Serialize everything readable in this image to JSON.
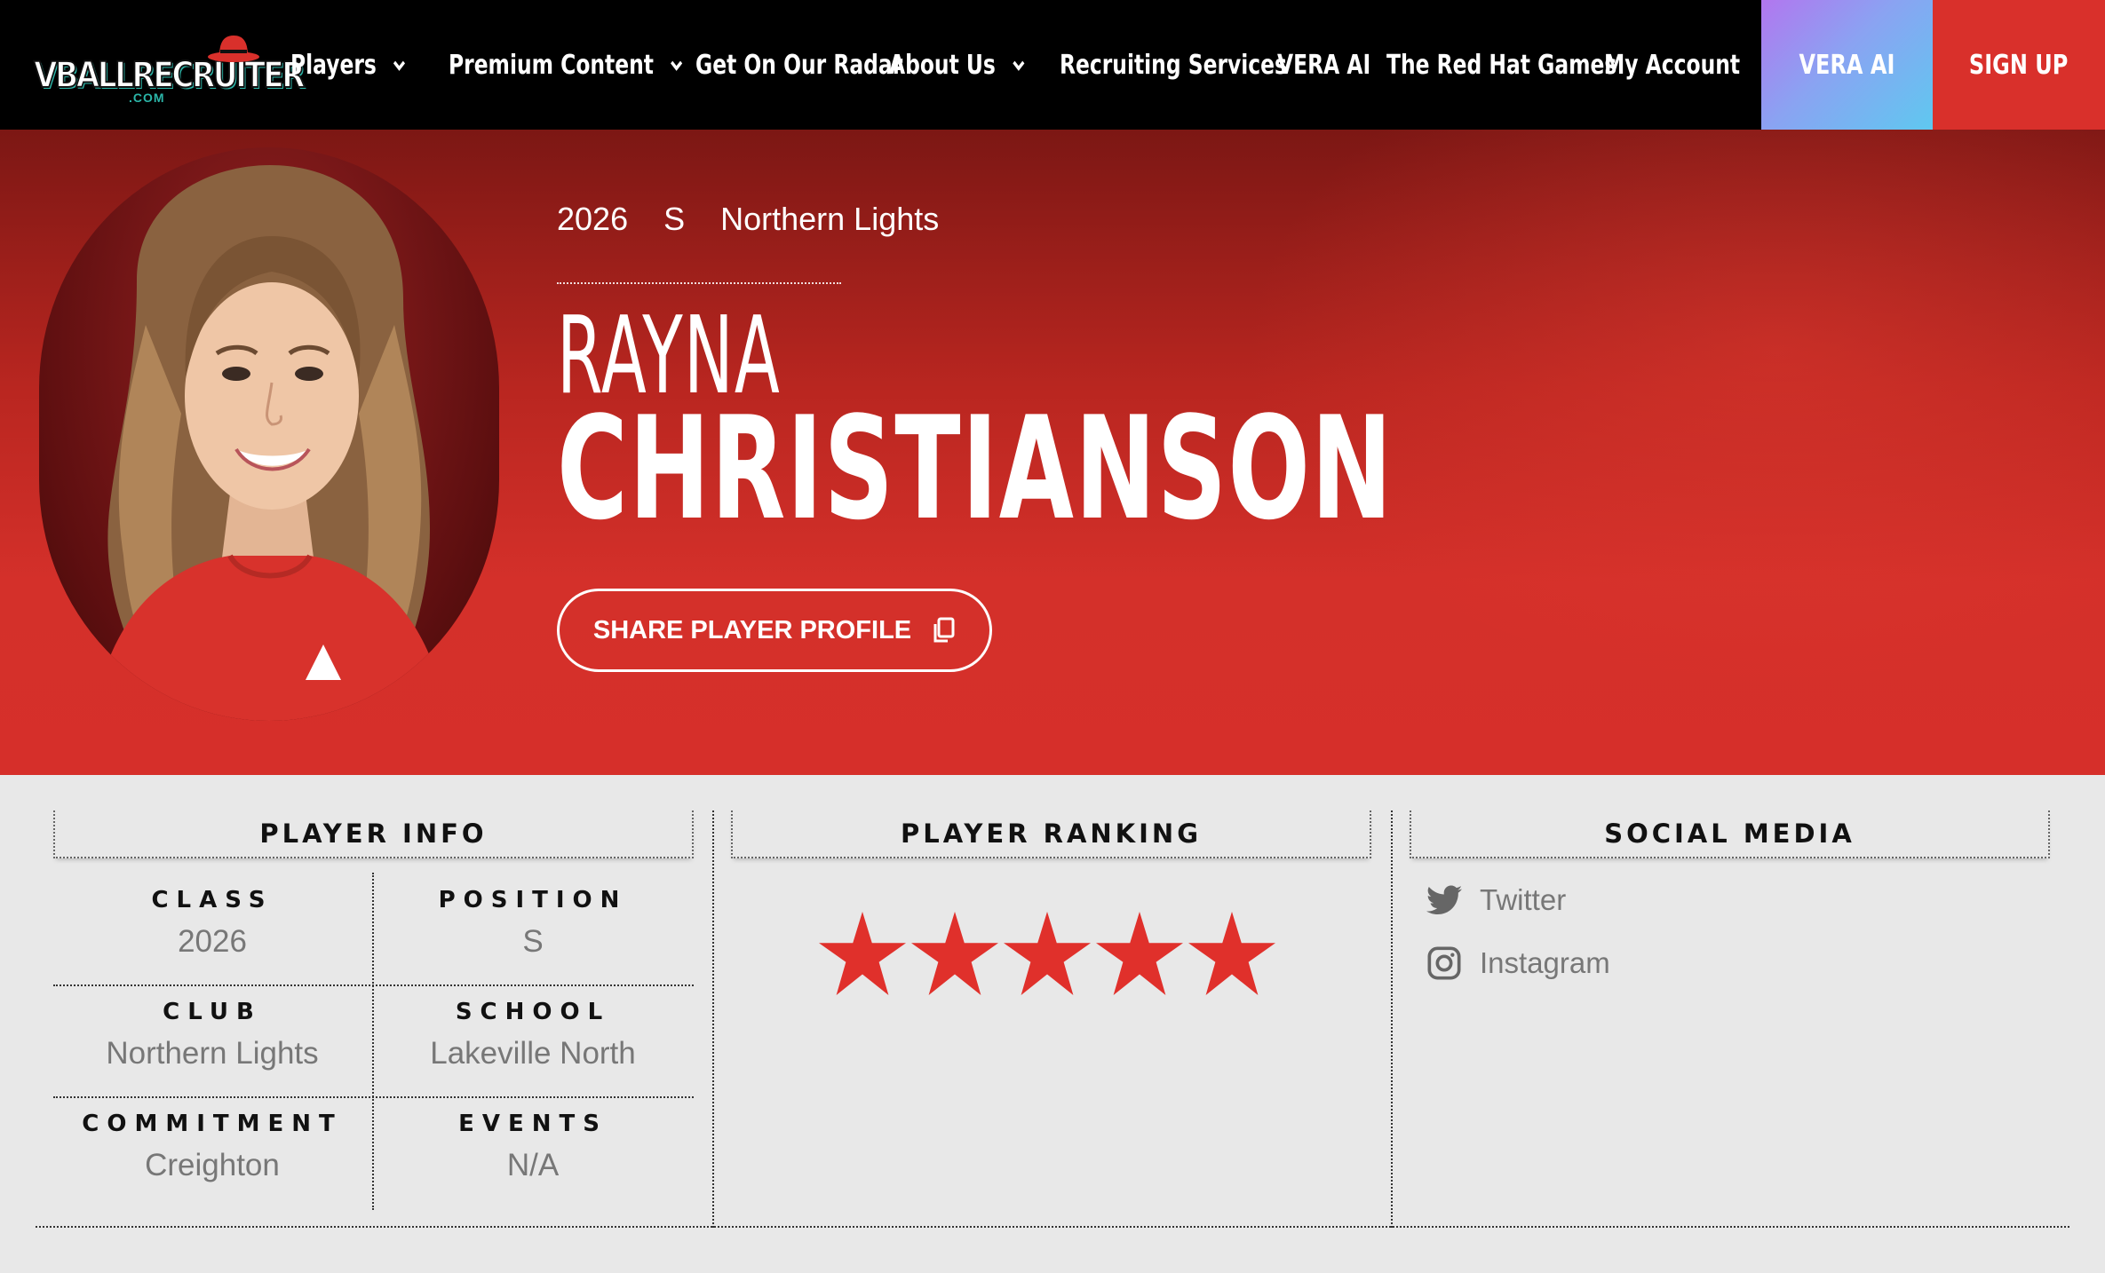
{
  "nav": {
    "logo_text": "VBALLRECRUITER",
    "logo_sub": ".COM",
    "items": [
      {
        "label": "Players",
        "has_dropdown": true
      },
      {
        "label": "Premium Content",
        "has_dropdown": true
      },
      {
        "label": "Get On Our Radar",
        "has_dropdown": false
      },
      {
        "label": "About Us",
        "has_dropdown": true
      },
      {
        "label": "Recruiting Services",
        "has_dropdown": false
      },
      {
        "label": "VERA AI",
        "has_dropdown": false
      },
      {
        "label": "The Red Hat Games",
        "has_dropdown": false
      },
      {
        "label": "My Account",
        "has_dropdown": false
      }
    ],
    "vera_button": "VERA AI",
    "signup_button": "SIGN UP"
  },
  "player": {
    "class_year": "2026",
    "position": "S",
    "club": "Northern Lights",
    "first_name": "RAYNA",
    "last_name": "CHRISTIANSON",
    "share_label": "SHARE PLAYER PROFILE"
  },
  "info": {
    "title": "PLAYER INFO",
    "cells": [
      {
        "label": "CLASS",
        "value": "2026"
      },
      {
        "label": "POSITION",
        "value": "S"
      },
      {
        "label": "CLUB",
        "value": "Northern Lights"
      },
      {
        "label": "SCHOOL",
        "value": "Lakeville North"
      },
      {
        "label": "COMMITMENT",
        "value": "Creighton"
      },
      {
        "label": "EVENTS",
        "value": "N/A"
      }
    ]
  },
  "ranking": {
    "title": "PLAYER RANKING",
    "stars": 5,
    "star_color": "#e0302b"
  },
  "social": {
    "title": "SOCIAL MEDIA",
    "links": [
      {
        "label": "Twitter",
        "icon": "twitter-icon"
      },
      {
        "label": "Instagram",
        "icon": "instagram-icon"
      }
    ]
  },
  "colors": {
    "nav_bg": "#000000",
    "brand_red": "#d9302b",
    "panel_bg": "#e8e8e8"
  }
}
